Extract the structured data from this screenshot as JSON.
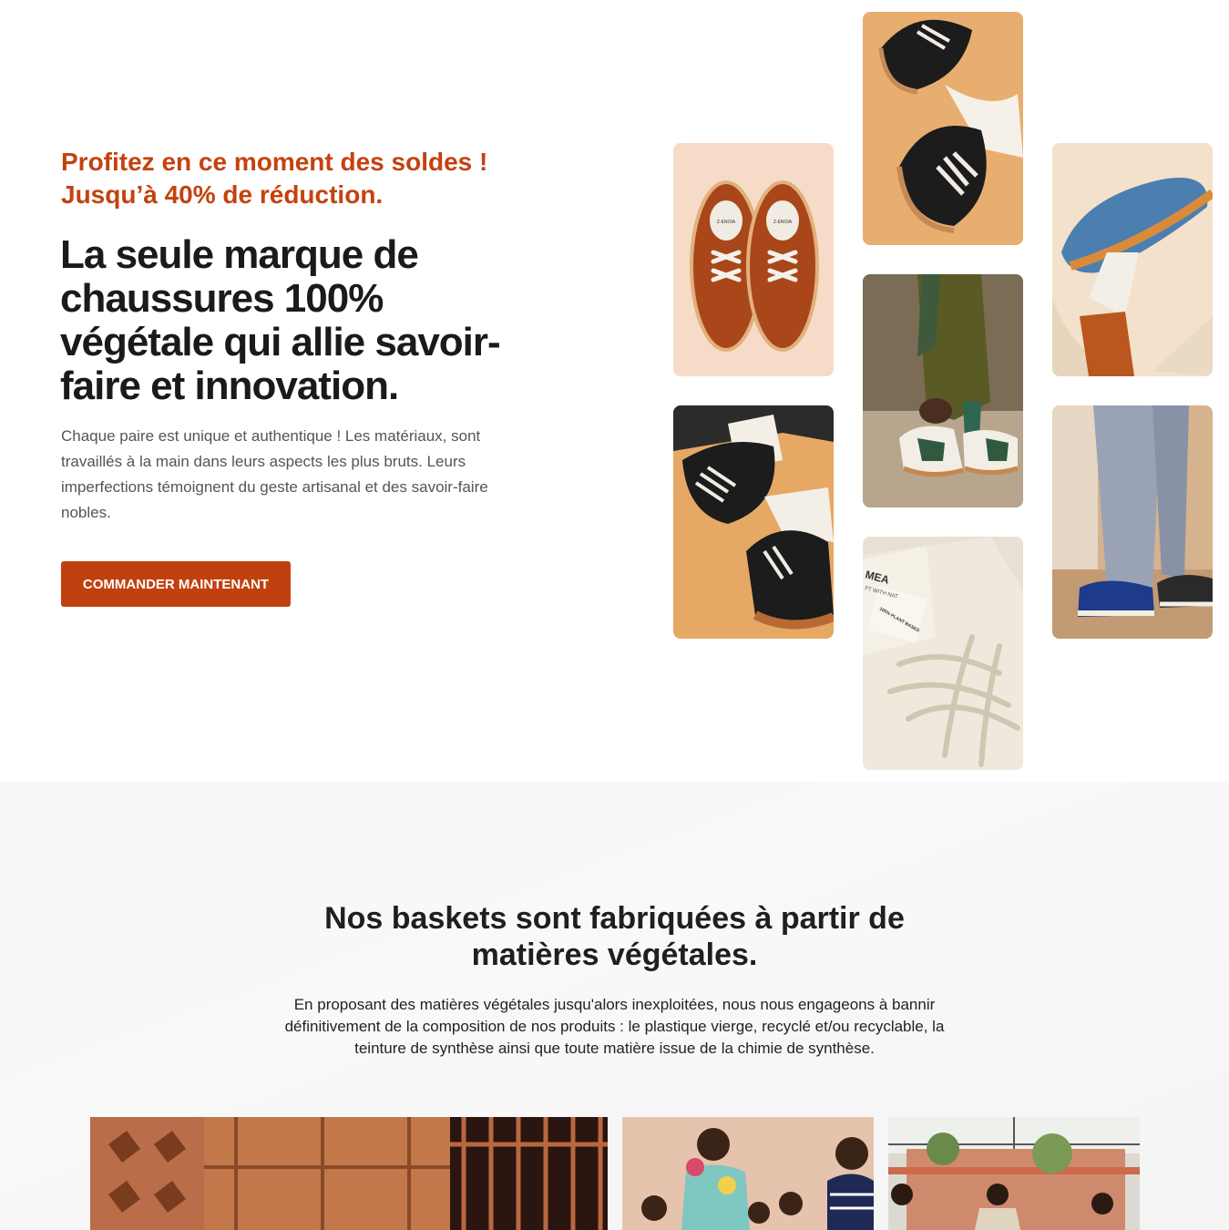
{
  "hero": {
    "promo_line1": "Profitez en ce moment des soldes !",
    "promo_line2": "Jusqu’à 40% de réduction.",
    "headline": "La seule marque de chaussures 100% végétale qui allie savoir-faire et innovation.",
    "description": "Chaque paire est unique et authentique ! Les matériaux, sont travaillés à la main dans leurs aspects les plus bruts. Leurs imperfections témoignent du geste artisanal et des savoir-faire nobles.",
    "cta_label": "COMMANDER MAINTENANT"
  },
  "gallery": {
    "label_a": "Z-ENOIA",
    "label_b": "Z-ENOIA",
    "tag_line1": "MEA",
    "tag_line2": "FT WITH NAT",
    "tag_line3": "100% PLANT BASED"
  },
  "materials": {
    "title": "Nos baskets sont fabriquées à partir de matières végétales.",
    "text": "En proposant des matières végétales jusqu'alors inexploitées, nous nous engageons à bannir définitivement de la composition de nos produits : le plastique vierge, recyclé et/ou recyclable, la teinture de synthèse ainsi que toute matière issue de la chimie de synthèse."
  },
  "colors": {
    "accent": "#c4420f",
    "button": "#c0410f",
    "section_bg": "#f6f6f6"
  }
}
